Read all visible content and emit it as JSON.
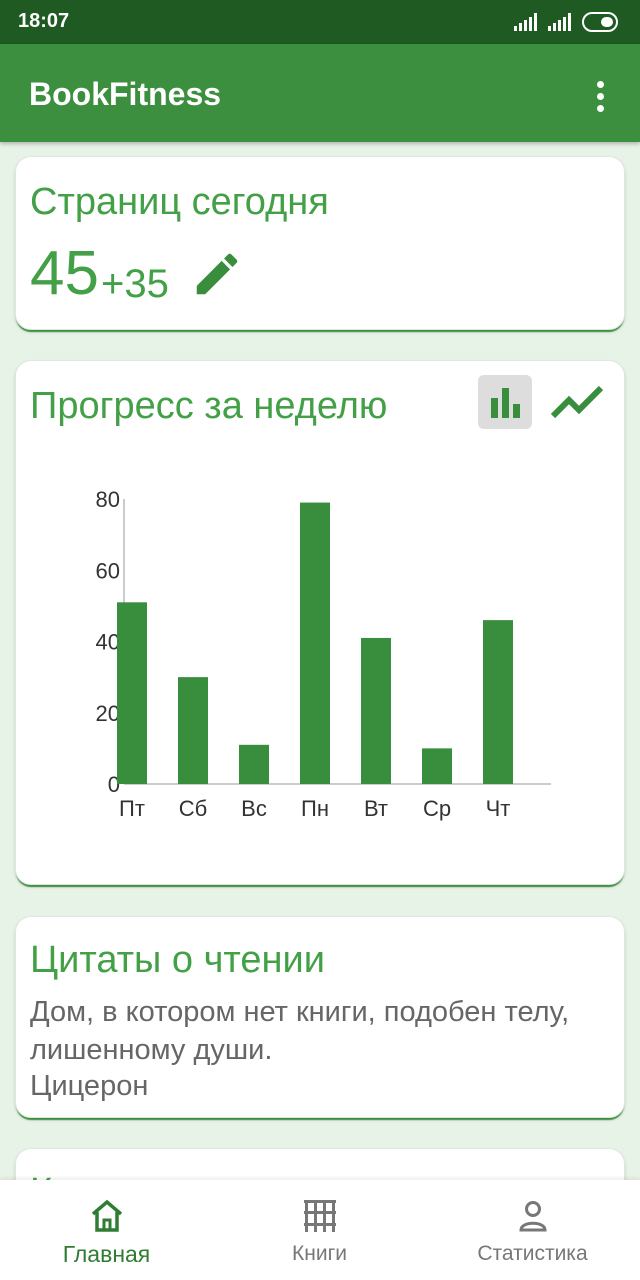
{
  "status_bar": {
    "time": "18:07"
  },
  "app_bar": {
    "title": "BookFitness"
  },
  "today": {
    "title": "Страниц сегодня",
    "pages": "45",
    "added": "+35"
  },
  "weekly": {
    "title": "Прогресс за неделю"
  },
  "chart_data": {
    "type": "bar",
    "categories": [
      "Пт",
      "Сб",
      "Вс",
      "Пн",
      "Вт",
      "Ср",
      "Чт"
    ],
    "values": [
      51,
      30,
      11,
      79,
      41,
      10,
      46
    ],
    "title": "",
    "xlabel": "",
    "ylabel": "",
    "ylim": [
      0,
      80
    ],
    "yticks": [
      0,
      20,
      40,
      60,
      80
    ],
    "grid": false,
    "bar_color": "#388e3c"
  },
  "quotes": {
    "title": "Цитаты о чтении",
    "text": "Дом, в котором нет книги, подобен телу, лишенному души.",
    "author": "Цицерон"
  },
  "next_card": {
    "title_partial": "К"
  },
  "bottom_nav": {
    "items": [
      {
        "label": "Главная",
        "icon": "home-icon",
        "active": true
      },
      {
        "label": "Книги",
        "icon": "books-icon",
        "active": false
      },
      {
        "label": "Статистика",
        "icon": "person-icon",
        "active": false
      }
    ]
  },
  "colors": {
    "primary": "#3d8f40",
    "primary_dark": "#1e5a22",
    "accent_text": "#43a047",
    "bar": "#388e3c",
    "background": "#e8f3e8"
  }
}
